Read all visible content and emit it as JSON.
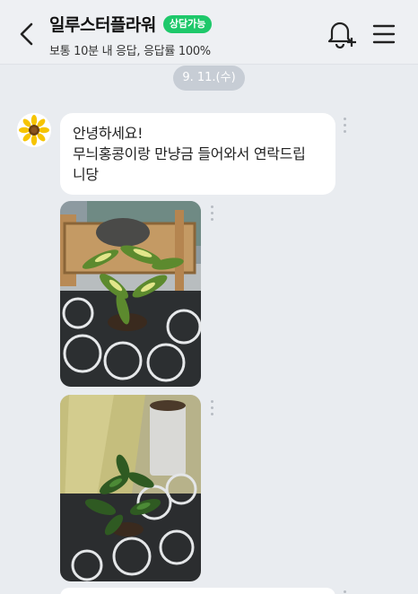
{
  "header": {
    "title": "일루스터플라워",
    "badge": "상담가능",
    "subtitle": "보통 10분 내 응답, 응답률 100%"
  },
  "date_separator": "9. 11.(수)",
  "messages": [
    {
      "lines": [
        "안녕하세요!",
        "무늬홍콩이랑 만냥금 들어와서 연락드립",
        "니당"
      ]
    }
  ],
  "icons": {
    "back": "chevron-left-icon",
    "bell": "bell-plus-icon",
    "menu": "hamburger-menu-icon",
    "more": "more-vertical-icon",
    "avatar": "sunflower-icon"
  },
  "colors": {
    "badge": "#1ec86a",
    "background": "#e9ecf0",
    "bubble": "#ffffff"
  }
}
